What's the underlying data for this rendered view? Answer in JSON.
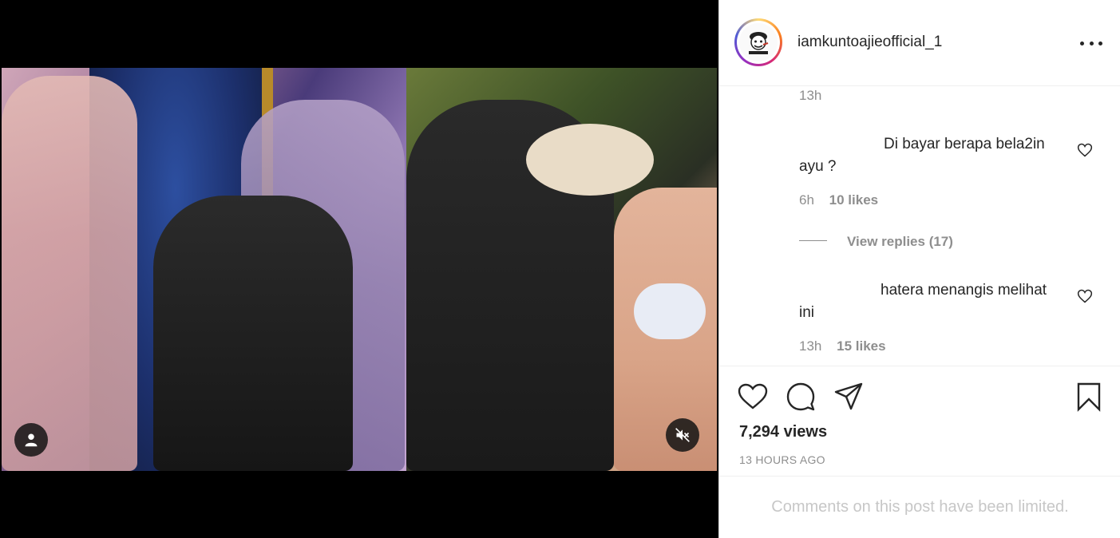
{
  "post": {
    "username": "iamkuntoajieofficial_1",
    "avatar_icon": "caricature-avatar",
    "top_timestamp": "13h"
  },
  "comments": [
    {
      "text": "Di bayar berapa bela2in ayu ?",
      "time": "6h",
      "likes": "10 likes",
      "view_replies": "View replies (17)"
    },
    {
      "text": "hatera menangis melihat ini",
      "time": "13h",
      "likes": "15 likes"
    }
  ],
  "actions": {
    "like_icon": "heart-icon",
    "comment_icon": "comment-icon",
    "share_icon": "paper-plane-icon",
    "save_icon": "bookmark-icon"
  },
  "stats": {
    "views": "7,294 views",
    "time_ago": "13 HOURS AGO"
  },
  "footer": {
    "limited_message": "Comments on this post have been limited."
  },
  "media": {
    "tag_icon": "user-tag-icon",
    "mute_icon": "muted-speaker-icon"
  },
  "colors": {
    "text": "#262626",
    "secondary": "#8e8e8e",
    "border": "#efefef",
    "disabled": "#c7c7c7"
  }
}
